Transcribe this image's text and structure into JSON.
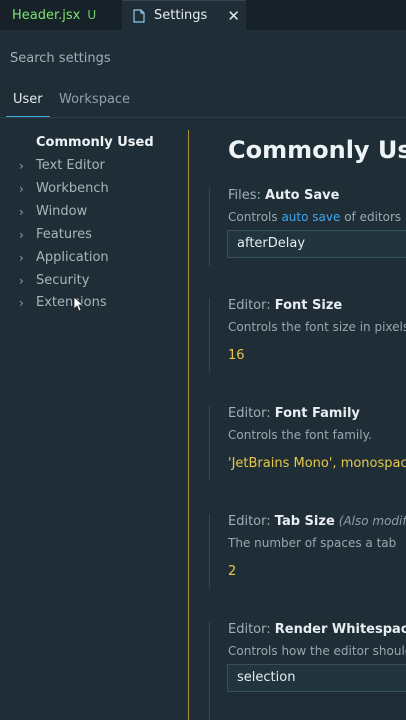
{
  "tabs": {
    "header_tab": {
      "label": "Header.jsx",
      "modified": "U"
    },
    "settings_tab": {
      "label": "Settings",
      "close": "✕"
    }
  },
  "search": {
    "placeholder": "Search settings"
  },
  "scope_tabs": {
    "user": "User",
    "workspace": "Workspace"
  },
  "tree": [
    {
      "label": "Commonly Used",
      "active": true
    },
    {
      "label": "Text Editor"
    },
    {
      "label": "Workbench"
    },
    {
      "label": "Window"
    },
    {
      "label": "Features"
    },
    {
      "label": "Application"
    },
    {
      "label": "Security"
    },
    {
      "label": "Extensions"
    }
  ],
  "page": {
    "title": "Commonly Used"
  },
  "settings": [
    {
      "category": "Files: ",
      "name": "Auto Save",
      "desc_pre": "Controls ",
      "desc_link": "auto save",
      "desc_post": " of editors",
      "value": "afterDelay"
    },
    {
      "category": "Editor: ",
      "name": "Font Size",
      "desc": "Controls the font size in pixels",
      "value": "16"
    },
    {
      "category": "Editor: ",
      "name": "Font Family",
      "desc": "Controls the font family.",
      "value": "'JetBrains Mono', monospace"
    },
    {
      "category": "Editor: ",
      "name": "Tab Size",
      "also": "(Also modified",
      "desc": "The number of spaces a tab",
      "value": "2"
    },
    {
      "category": "Editor: ",
      "name": "Render Whitespace",
      "desc": "Controls how the editor should",
      "value": "selection"
    }
  ],
  "colors": {
    "accent": "#3fa7d6",
    "value": "#e6c84a",
    "modified": "#6fcf6a"
  }
}
